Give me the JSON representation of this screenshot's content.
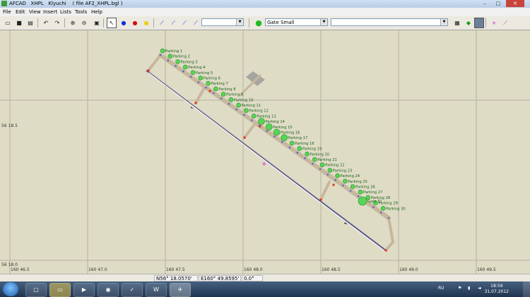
{
  "window": {
    "title": "AFCAD   XHPL   Klyuchi    ( file AF2_XHPL.bgl )",
    "minimize": "–",
    "maximize": "□",
    "close": "✕"
  },
  "menu": [
    "File",
    "Edit",
    "View",
    "Insert",
    "Lists",
    "Tools",
    "Help"
  ],
  "toolbar": {
    "parking_type": "Gate Small",
    "combo_empty": ""
  },
  "map": {
    "lat_labels": [
      "56 18.5",
      "56 18.0"
    ],
    "lon_labels": [
      "160 46.5",
      "160 47.0",
      "160 47.5",
      "160 48.0",
      "160 48.5",
      "160 49.0",
      "160 49.5"
    ],
    "parking_labels": [
      "Parking 1",
      "Parking 2",
      "Parking 3",
      "Parking 4",
      "Parking 5",
      "Parking 6",
      "Parking 7",
      "Parking 8",
      "Parking 9",
      "Parking 10",
      "Parking 11",
      "Parking 12",
      "Parking 13",
      "Parking 14",
      "Parking 15",
      "Parking 16",
      "Parking 17",
      "Parking 18",
      "Parking 19",
      "Parking 20",
      "Parking 21",
      "Parking 22",
      "Parking 23",
      "Parking 24",
      "Parking 25",
      "Parking 26",
      "Parking 27",
      "Parking 28",
      "Parking 29",
      "Parking 30",
      "Gate 31"
    ]
  },
  "status": {
    "latitude": "N56° 18.0570'",
    "longitude": "E160° 49.8595'",
    "heading": "0.0°"
  },
  "taskbar": {
    "lang": "RU",
    "time": "18:59",
    "date": "31.07.2012"
  },
  "colors": {
    "map_background": "#dfdcc5",
    "grid_line": "#b4b19e",
    "taxiway": "#c7b79c",
    "runway_line": "#555588",
    "parking_circle": "#55d655",
    "label_text": "#1b5e1b"
  }
}
